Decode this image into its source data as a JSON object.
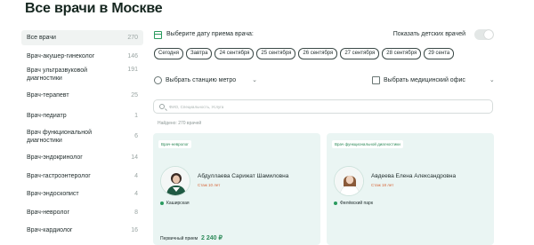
{
  "page": {
    "title": "Все врачи в Москве"
  },
  "sidebar": {
    "items": [
      {
        "label": "Все врачи",
        "count": "270"
      },
      {
        "label": "Врач-акушер-гинеколог",
        "count": "146"
      },
      {
        "label": "Врач ультразвуковой диагностики",
        "count": "191"
      },
      {
        "label": "Врач-терапевт",
        "count": "25"
      },
      {
        "label": "Врач-педиатр",
        "count": "1"
      },
      {
        "label": "Врач функциональной диагностики",
        "count": "6"
      },
      {
        "label": "Врач-эндокринолог",
        "count": "14"
      },
      {
        "label": "Врач-гастроэнтеролог",
        "count": "4"
      },
      {
        "label": "Врач-эндоскопист",
        "count": "4"
      },
      {
        "label": "Врач-невролог",
        "count": "8"
      },
      {
        "label": "Врач-кардиолог",
        "count": "16"
      }
    ]
  },
  "date_section": {
    "label": "Выберите дату приема врача:",
    "kids_toggle_label": "Показать детских врачей",
    "chips": [
      "Сегодня",
      "Завтра",
      "24 сентября",
      "25 сентября",
      "26 сентября",
      "27 сентября",
      "28 сентября",
      "29 сента"
    ]
  },
  "filters": {
    "metro": "Выбрать станцию метро",
    "office": "Выбрать медицинский офис"
  },
  "search": {
    "placeholder": "ФИО, Специальность, Услуга"
  },
  "found_text": "Найдено: 270 врачей",
  "cards": [
    {
      "specialty": "Врач-невролог",
      "name": "Абдуллаева Сарижат Шамиловна",
      "experience": "Стаж 10 лет",
      "metro": "Каширская",
      "price_label": "Первичный прием",
      "price": "2 240 ₽"
    },
    {
      "specialty": "Врач функциональной диагностики",
      "name": "Авдеева Елена Александровна",
      "experience": "Стаж 18 лет",
      "metro": "Филёвский парк"
    }
  ],
  "colors": {
    "accent": "#2a9a5e",
    "card_bg": "#eaf5f3",
    "experience": "#d6673a"
  }
}
